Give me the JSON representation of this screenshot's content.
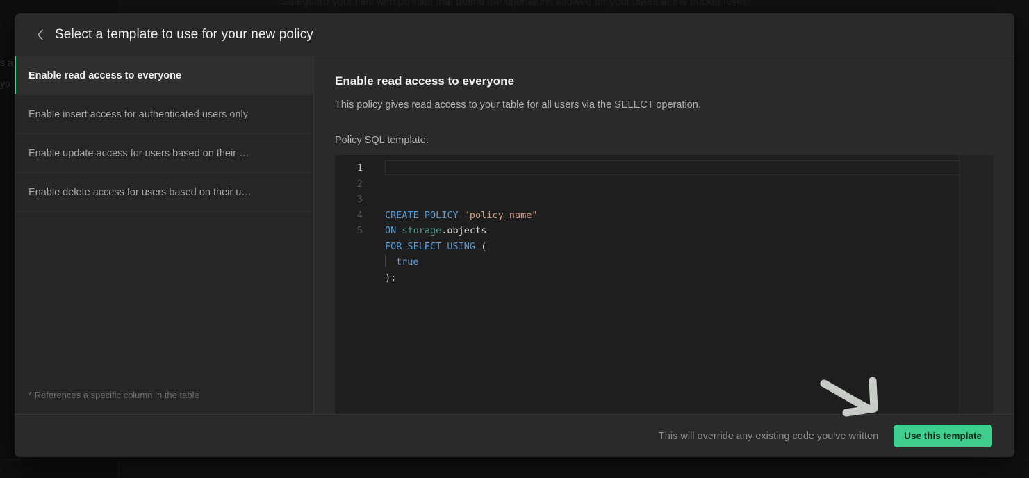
{
  "background": {
    "headline": "Safeguard your files with policies that define the operations allowed for your users at the bucket level.",
    "sidebar_fragment_1": "s a",
    "sidebar_fragment_2": "yo"
  },
  "modal": {
    "header": {
      "back_icon": "chevron-left-icon",
      "title": "Select a template to use for your new policy"
    },
    "templates": [
      {
        "label": "Enable read access to everyone",
        "selected": true
      },
      {
        "label": "Enable insert access for authenticated users only",
        "selected": false
      },
      {
        "label": "Enable update access for users based on their …",
        "selected": false
      },
      {
        "label": "Enable delete access for users based on their u…",
        "selected": false
      }
    ],
    "list_footnote": "* References a specific column in the table",
    "detail": {
      "title": "Enable read access to everyone",
      "description": "This policy gives read access to your table for all users via the SELECT operation.",
      "sql_label": "Policy SQL template:"
    },
    "code": {
      "line_numbers": [
        "1",
        "2",
        "3",
        "4",
        "5"
      ],
      "active_line": 1,
      "lines": [
        [
          {
            "t": "CREATE POLICY ",
            "c": "kw"
          },
          {
            "t": "\"policy_name\"",
            "c": "str"
          }
        ],
        [
          {
            "t": "ON ",
            "c": "kw"
          },
          {
            "t": "storage",
            "c": "tbl"
          },
          {
            "t": ".objects",
            "c": "pln"
          }
        ],
        [
          {
            "t": "FOR SELECT USING ",
            "c": "kw"
          },
          {
            "t": "(",
            "c": "pln"
          }
        ],
        [
          {
            "t": "GUIDE",
            "c": "guide"
          },
          {
            "t": "true",
            "c": "kw"
          }
        ],
        [
          {
            "t": ");",
            "c": "pln"
          }
        ]
      ],
      "plain_text": "CREATE POLICY \"policy_name\"\nON storage.objects\nFOR SELECT USING (\n  true\n);"
    },
    "footer": {
      "note": "This will override any existing code you've written",
      "button_label": "Use this template"
    }
  },
  "annotation": {
    "type": "hand-drawn-arrow",
    "points_to": "use-this-template-button",
    "color": "#c9cbc9"
  },
  "colors": {
    "accent_green": "#3ecf8e",
    "modal_bg": "#2a2a2a",
    "list_bg": "#262626",
    "editor_bg": "#1e1e1e",
    "keyword": "#569cd6",
    "string": "#d7a08a",
    "table": "#4d9b8f"
  }
}
